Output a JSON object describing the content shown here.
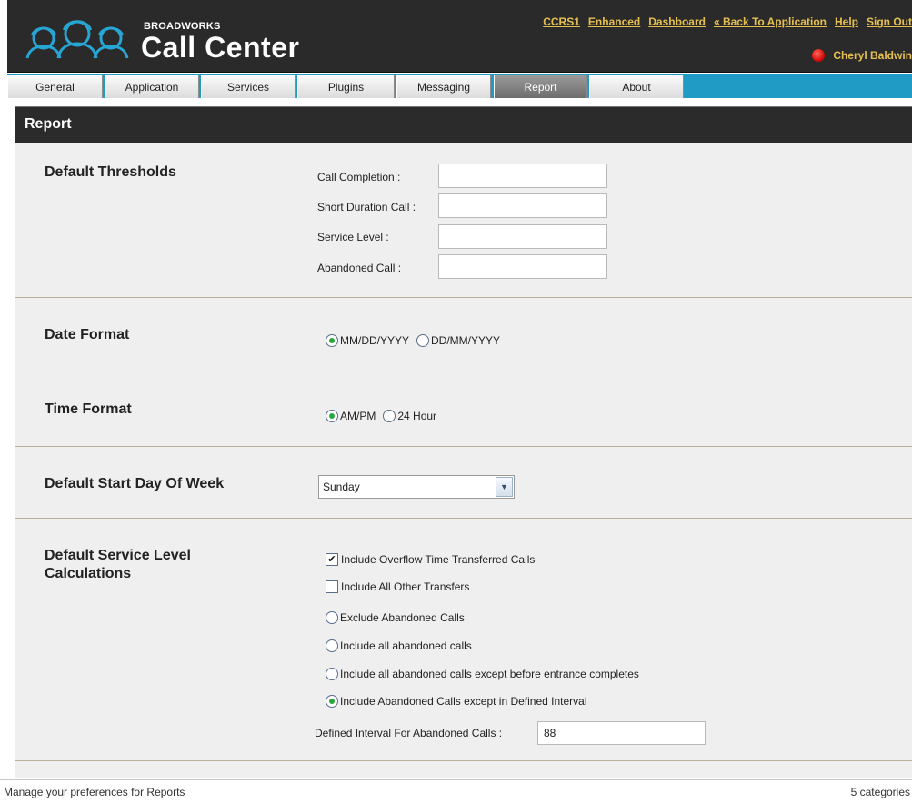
{
  "header": {
    "brand_small": "BROADWORKS",
    "brand_big": "Call Center",
    "links": [
      "CCRS1",
      "Enhanced",
      "Dashboard",
      "« Back To Application",
      "Help",
      "Sign Out"
    ],
    "user_name": "Cheryl Baldwin",
    "status_color": "#d90e0e",
    "link_color": "#e5c050"
  },
  "tabs": [
    {
      "label": "General",
      "active": false
    },
    {
      "label": "Application",
      "active": false
    },
    {
      "label": "Services",
      "active": false
    },
    {
      "label": "Plugins",
      "active": false
    },
    {
      "label": "Messaging",
      "active": false
    },
    {
      "label": "Report",
      "active": true
    },
    {
      "label": "About",
      "active": false
    }
  ],
  "page_title": "Report",
  "sections": {
    "thresholds": {
      "title": "Default Thresholds",
      "fields": [
        {
          "label": "Call Completion :",
          "value": ""
        },
        {
          "label": "Short Duration Call :",
          "value": ""
        },
        {
          "label": "Service Level :",
          "value": ""
        },
        {
          "label": "Abandoned Call :",
          "value": ""
        }
      ]
    },
    "date_format": {
      "title": "Date Format",
      "options": [
        {
          "label": "MM/DD/YYYY",
          "selected": true
        },
        {
          "label": "DD/MM/YYYY",
          "selected": false
        }
      ]
    },
    "time_format": {
      "title": "Time Format",
      "options": [
        {
          "label": "AM/PM",
          "selected": true
        },
        {
          "label": "24 Hour",
          "selected": false
        }
      ]
    },
    "start_day": {
      "title": "Default Start Day Of Week",
      "selected": "Sunday"
    },
    "service_level": {
      "title_line1": "Default Service Level",
      "title_line2": "Calculations",
      "checkboxes": [
        {
          "label": "Include Overflow Time Transferred Calls",
          "checked": true
        },
        {
          "label": "Include All Other Transfers",
          "checked": false
        }
      ],
      "radios": [
        {
          "label": "Exclude Abandoned Calls",
          "selected": false
        },
        {
          "label": "Include all abandoned calls",
          "selected": false
        },
        {
          "label": "Include all abandoned calls except before entrance completes",
          "selected": false
        },
        {
          "label": "Include Abandoned Calls except in Defined Interval",
          "selected": true
        }
      ],
      "interval_label": "Defined Interval For Abandoned Calls :",
      "interval_value": "88"
    }
  },
  "status": {
    "left": "Manage your preferences for Reports",
    "right": "5 categories"
  }
}
